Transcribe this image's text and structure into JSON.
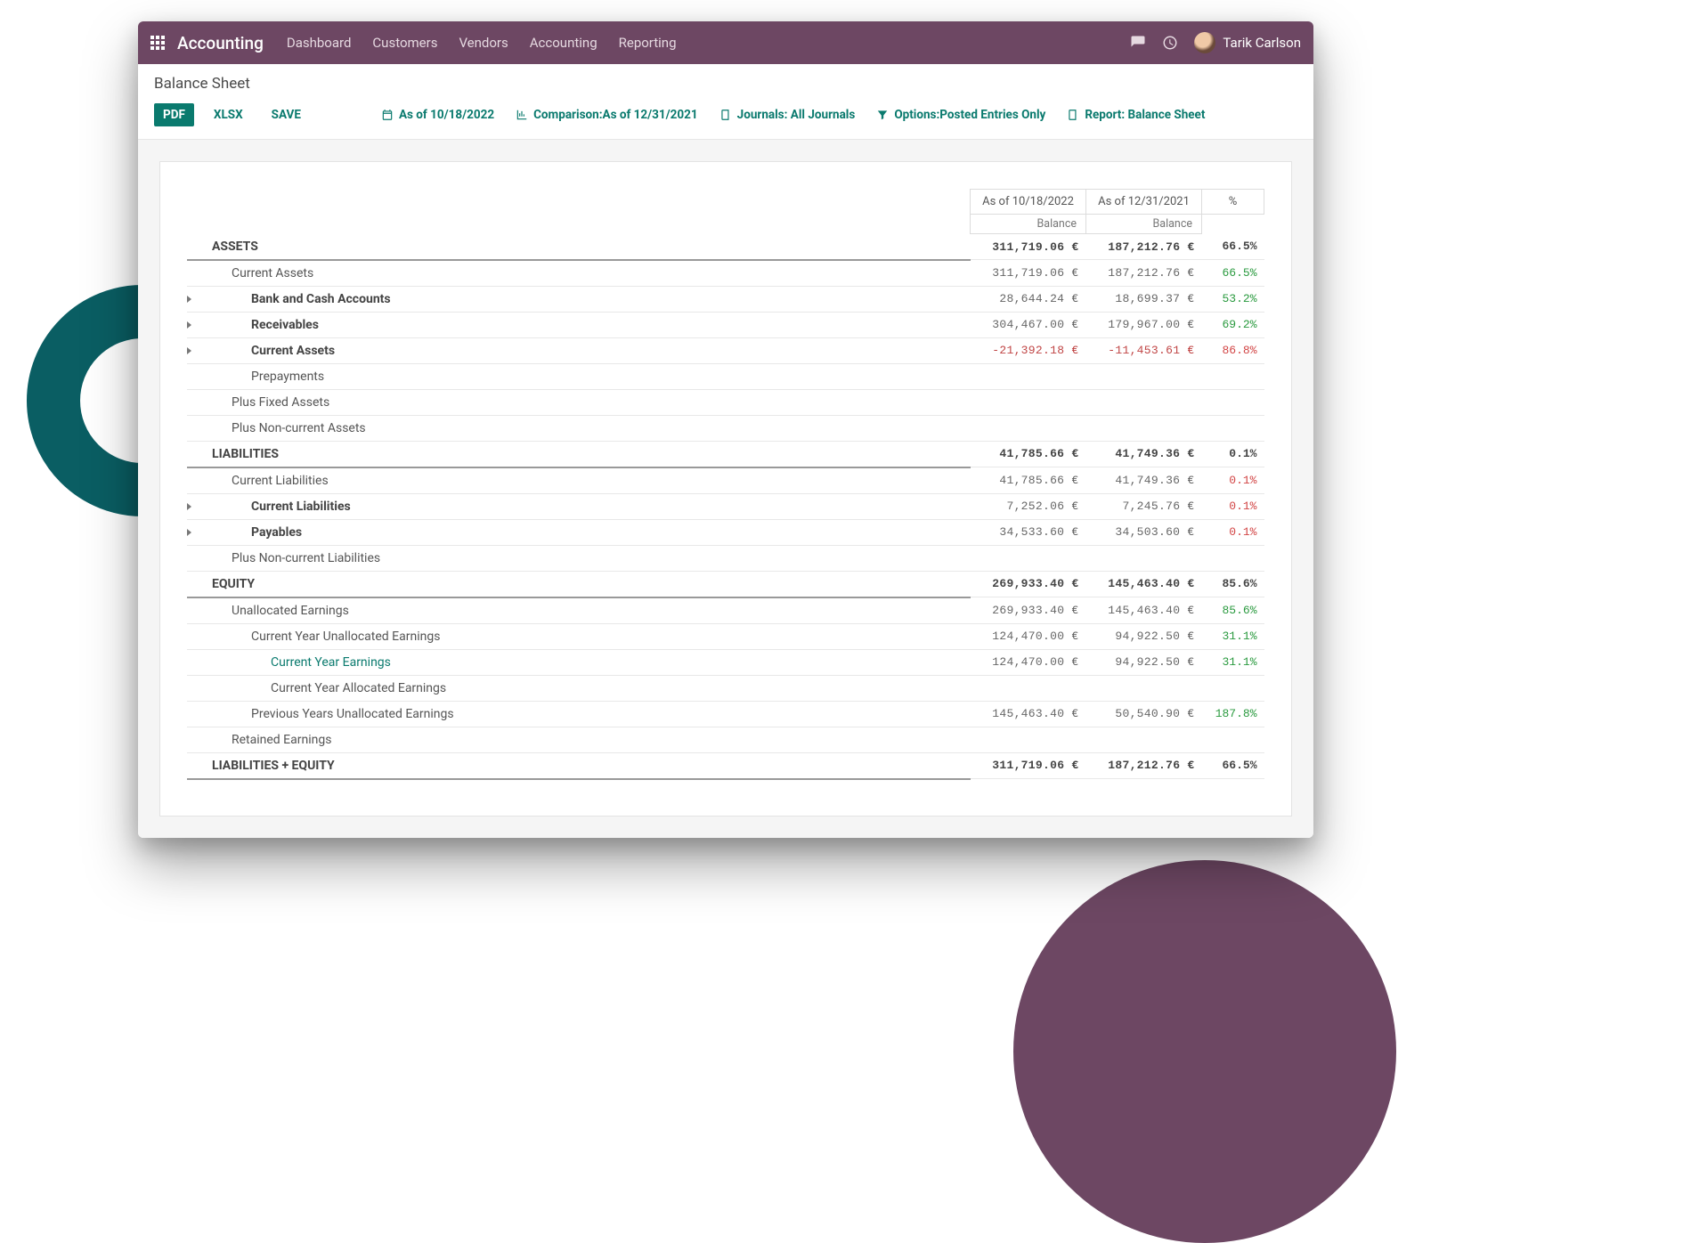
{
  "topbar": {
    "app_title": "Accounting",
    "nav": [
      "Dashboard",
      "Customers",
      "Vendors",
      "Accounting",
      "Reporting"
    ],
    "user_name": "Tarik Carlson"
  },
  "page_title": "Balance Sheet",
  "toolbar": {
    "pdf": "PDF",
    "xlsx": "XLSX",
    "save": "SAVE",
    "as_of": "As of 10/18/2022",
    "comparison": "Comparison:As of 12/31/2021",
    "journals": "Journals: All Journals",
    "options": "Options:Posted Entries Only",
    "report": "Report: Balance Sheet"
  },
  "headers": {
    "col1": "As of 10/18/2022",
    "col2": "As of 12/31/2021",
    "pct": "%",
    "balance": "Balance"
  },
  "rows": [
    {
      "label": "ASSETS",
      "indent": 0,
      "bold": true,
      "heavy": true,
      "v1": "311,719.06 €",
      "v2": "187,212.76 €",
      "pct": "66.5%",
      "pct_class": "green"
    },
    {
      "label": "Current Assets",
      "indent": 1,
      "v1": "311,719.06 €",
      "v2": "187,212.76 €",
      "pct": "66.5%",
      "pct_class": "green"
    },
    {
      "label": "Bank and Cash Accounts",
      "indent": 2,
      "caret": true,
      "bold": true,
      "v1": "28,644.24 €",
      "v2": "18,699.37 €",
      "pct": "53.2%",
      "pct_class": "green"
    },
    {
      "label": "Receivables",
      "indent": 2,
      "caret": true,
      "bold": true,
      "v1": "304,467.00 €",
      "v2": "179,967.00 €",
      "pct": "69.2%",
      "pct_class": "green"
    },
    {
      "label": "Current Assets",
      "indent": 2,
      "caret": true,
      "bold": true,
      "v1": "-21,392.18 €",
      "v1_neg": true,
      "v2": "-11,453.61 €",
      "v2_neg": true,
      "pct": "86.8%",
      "pct_class": "red"
    },
    {
      "label": "Prepayments",
      "indent": 2
    },
    {
      "label": "Plus Fixed Assets",
      "indent": 1
    },
    {
      "label": "Plus Non-current Assets",
      "indent": 1
    },
    {
      "label": "LIABILITIES",
      "indent": 0,
      "bold": true,
      "heavy": true,
      "v1": "41,785.66 €",
      "v2": "41,749.36 €",
      "pct": "0.1%",
      "pct_class": "red"
    },
    {
      "label": "Current Liabilities",
      "indent": 1,
      "v1": "41,785.66 €",
      "v2": "41,749.36 €",
      "pct": "0.1%",
      "pct_class": "red"
    },
    {
      "label": "Current Liabilities",
      "indent": 2,
      "caret": true,
      "bold": true,
      "v1": "7,252.06 €",
      "v2": "7,245.76 €",
      "pct": "0.1%",
      "pct_class": "red"
    },
    {
      "label": "Payables",
      "indent": 2,
      "caret": true,
      "bold": true,
      "v1": "34,533.60 €",
      "v2": "34,503.60 €",
      "pct": "0.1%",
      "pct_class": "red"
    },
    {
      "label": "Plus Non-current Liabilities",
      "indent": 1
    },
    {
      "label": "EQUITY",
      "indent": 0,
      "bold": true,
      "heavy": true,
      "v1": "269,933.40 €",
      "v2": "145,463.40 €",
      "pct": "85.6%",
      "pct_class": "green"
    },
    {
      "label": "Unallocated Earnings",
      "indent": 1,
      "v1": "269,933.40 €",
      "v2": "145,463.40 €",
      "pct": "85.6%",
      "pct_class": "green"
    },
    {
      "label": "Current Year Unallocated Earnings",
      "indent": 2,
      "v1": "124,470.00 €",
      "v2": "94,922.50 €",
      "pct": "31.1%",
      "pct_class": "green"
    },
    {
      "label": "Current Year Earnings",
      "indent": 3,
      "link": true,
      "v1": "124,470.00 €",
      "v2": "94,922.50 €",
      "pct": "31.1%",
      "pct_class": "green"
    },
    {
      "label": "Current Year Allocated Earnings",
      "indent": 3
    },
    {
      "label": "Previous Years Unallocated Earnings",
      "indent": 2,
      "v1": "145,463.40 €",
      "v2": "50,540.90 €",
      "pct": "187.8%",
      "pct_class": "green"
    },
    {
      "label": "Retained Earnings",
      "indent": 1
    },
    {
      "label": "LIABILITIES + EQUITY",
      "indent": 0,
      "bold": true,
      "heavy": true,
      "v1": "311,719.06 €",
      "v2": "187,212.76 €",
      "pct": "66.5%",
      "pct_class": "red"
    }
  ]
}
